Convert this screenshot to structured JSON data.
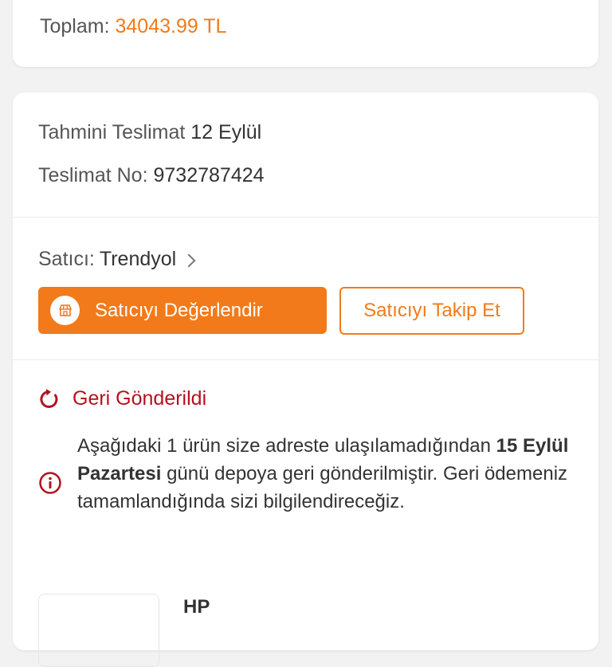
{
  "summary": {
    "total_label": "Toplam:",
    "total_value": "34043.99 TL"
  },
  "delivery": {
    "estimate_label": "Tahmini Teslimat",
    "estimate_value": "12 Eylül",
    "number_label": "Teslimat No:",
    "number_value": "9732787424"
  },
  "seller": {
    "label": "Satıcı:",
    "name": "Trendyol",
    "rate_button": "Satıcıyı Değerlendir",
    "follow_button": "Satıcıyı Takip Et"
  },
  "return_info": {
    "status": "Geri Gönderildi",
    "message_part1": "Aşağıdaki 1 ürün size adreste ulaşılamadığından",
    "message_bold": "15 Eylül Pazartesi",
    "message_part2": "günü depoya geri gönderilmiştir. Geri ödemeniz tamamlandığında sizi bilgilendireceğiz."
  },
  "product": {
    "brand": "HP"
  },
  "colors": {
    "accent": "#f27a1a",
    "alert": "#b3121f"
  },
  "icons": {
    "store": "store-icon",
    "chevron": "chevron-right-icon",
    "refresh": "refresh-icon",
    "info": "info-icon"
  }
}
